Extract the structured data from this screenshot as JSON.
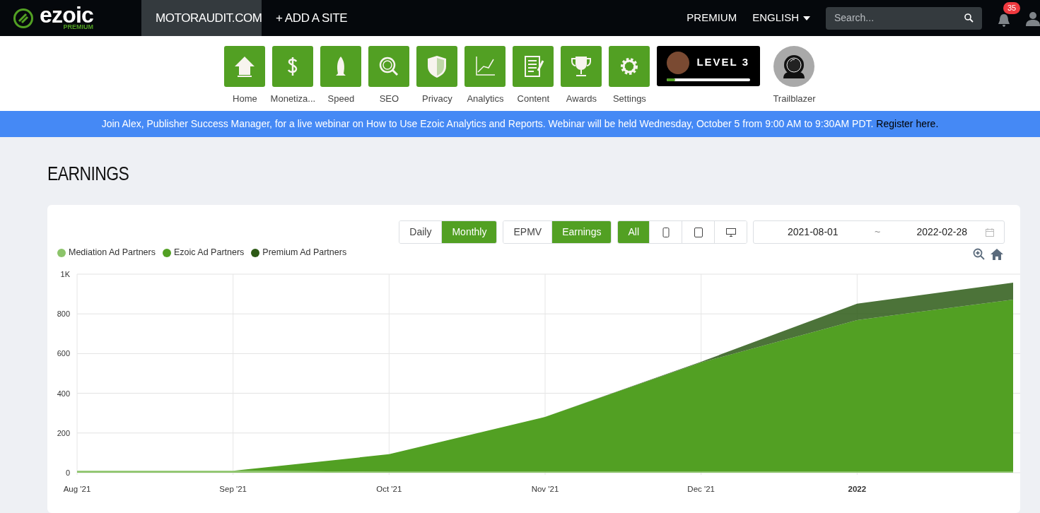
{
  "navbar": {
    "logo": {
      "wordmark": "ezoic",
      "tier": "PREMIUM"
    },
    "site_tabs": [
      {
        "label": "MOTORAUDIT.COM",
        "selected": true
      },
      {
        "label": "+ ADD A SITE",
        "selected": false
      }
    ],
    "links": [
      {
        "label": "PREMIUM",
        "kind": "link"
      },
      {
        "label": "ENGLISH",
        "kind": "dropdown"
      }
    ],
    "search": {
      "placeholder": "Search..."
    },
    "notifications": {
      "count": "35"
    }
  },
  "app_icons": [
    {
      "label": "Home",
      "kind": "home"
    },
    {
      "label": "Monetiza...",
      "kind": "dollar"
    },
    {
      "label": "Speed",
      "kind": "rocket"
    },
    {
      "label": "SEO",
      "kind": "seo"
    },
    {
      "label": "Privacy",
      "kind": "shield"
    },
    {
      "label": "Analytics",
      "kind": "chart"
    },
    {
      "label": "Content",
      "kind": "content"
    },
    {
      "label": "Awards",
      "kind": "trophy"
    },
    {
      "label": "Settings",
      "kind": "gear"
    }
  ],
  "level_card": {
    "title": "LEVEL 3",
    "level": 0.1
  },
  "badge": {
    "label": "Trailblazer"
  },
  "banner": {
    "text": "Join Alex, Publisher Success Manager, for a live webinar on How to Use Ezoic Analytics and Reports. Webinar will be held Wednesday, October 5 from 9:00 AM to 9:30AM PDT.",
    "link": "Register here."
  },
  "earnings": {
    "title": "EARNINGS",
    "toggle_groups": [
      [
        {
          "kind": "text",
          "label": "Daily",
          "selected": false
        },
        {
          "kind": "text",
          "label": "Monthly",
          "selected": true
        }
      ],
      [
        {
          "kind": "text",
          "label": "EPMV",
          "selected": false
        },
        {
          "kind": "text",
          "label": "Earnings",
          "selected": true
        }
      ],
      [
        {
          "kind": "text",
          "label": "All",
          "selected": true
        },
        {
          "kind": "phone",
          "selected": false
        },
        {
          "kind": "tablet",
          "selected": false
        },
        {
          "kind": "desktop",
          "selected": false
        }
      ]
    ],
    "date_range": {
      "start": "2021-08-01",
      "separator": "~",
      "end": "2022-02-28"
    },
    "chart_data": {
      "type": "area",
      "stacked": true,
      "categories": [
        "Aug '21",
        "Sep '21",
        "Oct '21",
        "Nov '21",
        "Dec '21",
        "2022",
        null
      ],
      "yticks": [
        {
          "value": 0,
          "label": "0"
        },
        {
          "value": 200,
          "label": "200"
        },
        {
          "value": 400,
          "label": "400"
        },
        {
          "value": 600,
          "label": "600"
        },
        {
          "value": 800,
          "label": "800"
        },
        {
          "value": 1000,
          "label": "1K"
        }
      ],
      "ylim": [
        0,
        1000
      ],
      "grid": true,
      "series": [
        {
          "name": "Mediation Ad Partners",
          "color": "#8cc46a",
          "values": [
            10,
            10,
            5,
            5,
            5,
            5,
            5
          ]
        },
        {
          "name": "Ezoic Ad Partners",
          "color": "#52a023",
          "values": [
            0,
            0,
            88,
            276,
            550,
            764,
            867
          ]
        },
        {
          "name": "Premium Ad Partners",
          "color": "#2d5a16",
          "values": [
            0,
            0,
            0,
            0,
            4,
            82,
            85
          ]
        }
      ]
    }
  }
}
